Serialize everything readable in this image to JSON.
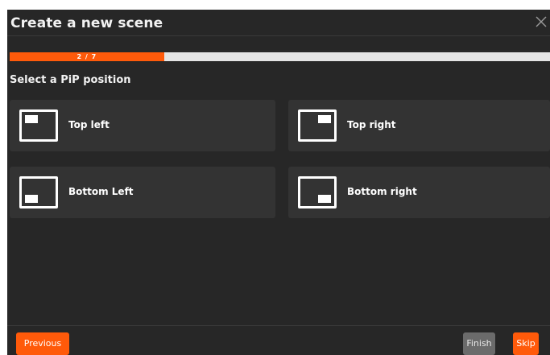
{
  "dialog": {
    "title": "Create a new scene",
    "close_icon": "close-icon"
  },
  "progress": {
    "text": "2 / 7",
    "current": 2,
    "total": 7,
    "fill_color": "#ff5a0a",
    "track_color": "#e4e4e4"
  },
  "prompt": "Select a PiP position",
  "options": [
    {
      "label": "Top left",
      "icon": "pip-top-left-icon"
    },
    {
      "label": "Top right",
      "icon": "pip-top-right-icon"
    },
    {
      "label": "Bottom Left",
      "icon": "pip-bottom-left-icon"
    },
    {
      "label": "Bottom right",
      "icon": "pip-bottom-right-icon"
    }
  ],
  "footer": {
    "previous_label": "Previous",
    "finish_label": "Finish",
    "skip_label": "Skip"
  },
  "colors": {
    "accent": "#ff5a0a",
    "background": "#272727",
    "card": "#333333",
    "disabled_button": "#6b6b6b"
  }
}
